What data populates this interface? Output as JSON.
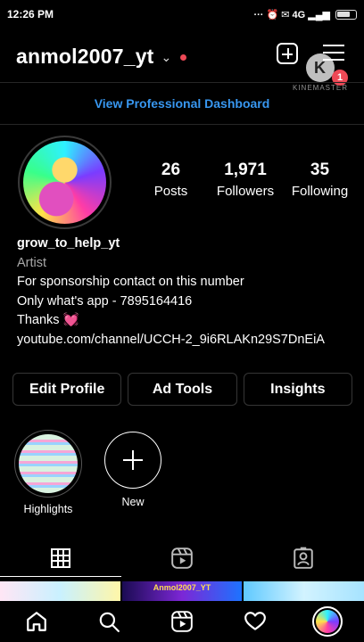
{
  "status_bar": {
    "time": "12:26 PM",
    "right_indicators": "··· ⏰ ✉ 4G ▂▄▆"
  },
  "header": {
    "username": "anmol2007_yt",
    "notification_count": "1",
    "watermark": "KINEMASTER",
    "watermark_letter": "K"
  },
  "dashboard_link": "View Professional Dashboard",
  "stats": [
    {
      "value": "26",
      "label": "Posts"
    },
    {
      "value": "1,971",
      "label": "Followers"
    },
    {
      "value": "35",
      "label": "Following"
    }
  ],
  "bio": {
    "name": "grow_to_help_yt",
    "category": "Artist",
    "line1": "For sponsorship contact on this number",
    "line2": "Only what's app - 7895164416",
    "line3": "Thanks",
    "link": "youtube.com/channel/UCCH-2_9i6RLAKn29S7DnEiA"
  },
  "buttons": {
    "edit_profile": "Edit Profile",
    "ad_tools": "Ad Tools",
    "insights": "Insights"
  },
  "highlights": [
    {
      "label": "Highlights"
    },
    {
      "label": "New"
    }
  ],
  "thumbnail_caption": "Anmol2007_YT",
  "colors": {
    "accent_blue": "#3897f0",
    "badge_red": "#ed4956",
    "background": "#000000"
  }
}
